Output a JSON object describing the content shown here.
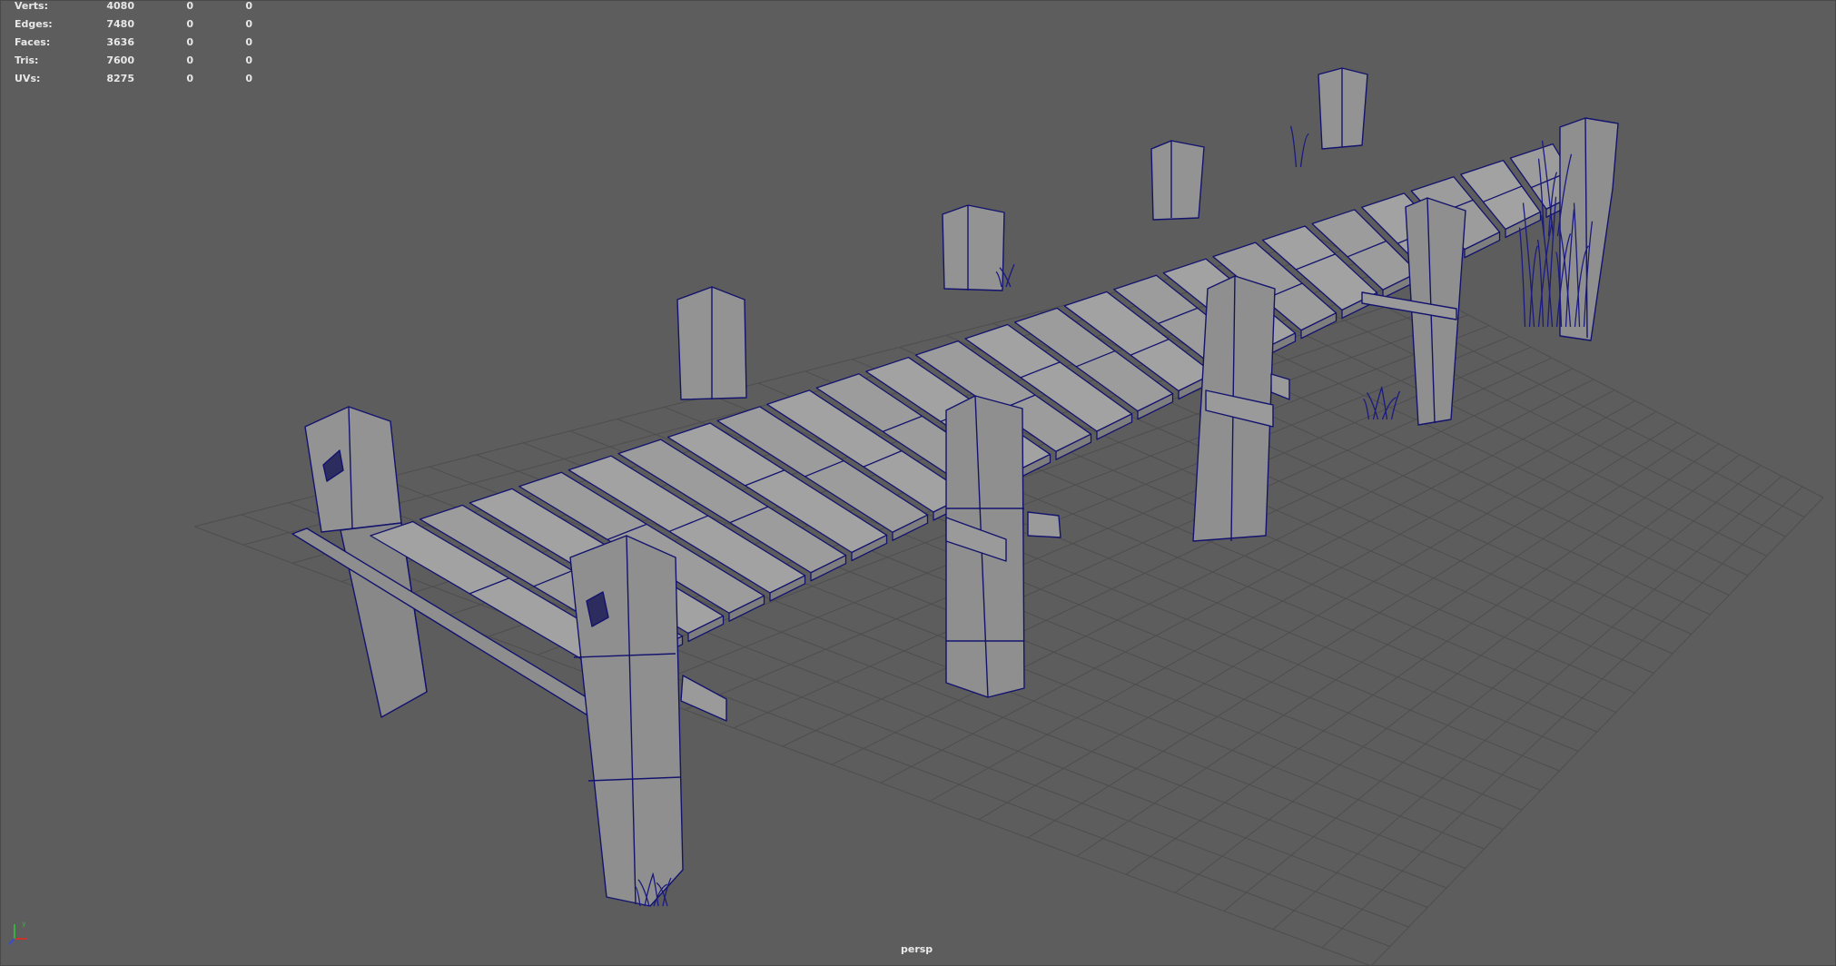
{
  "hud": {
    "rows": [
      {
        "label": "Verts:",
        "values": [
          "4080",
          "0",
          "0"
        ]
      },
      {
        "label": "Edges:",
        "values": [
          "7480",
          "0",
          "0"
        ]
      },
      {
        "label": "Faces:",
        "values": [
          "3636",
          "0",
          "0"
        ]
      },
      {
        "label": "Tris:",
        "values": [
          "7600",
          "0",
          "0"
        ]
      },
      {
        "label": "UVs:",
        "values": [
          "8275",
          "0",
          "0"
        ]
      }
    ]
  },
  "viewport": {
    "camera_label": "persp"
  },
  "colors": {
    "background": "#5d5d5d",
    "grid": "#4e4e4e",
    "mesh_face": "#959595",
    "wireframe": "#13136e",
    "hud_text": "#e8e8e8"
  },
  "icons": {
    "view_axis": "xyz-axis-icon"
  }
}
